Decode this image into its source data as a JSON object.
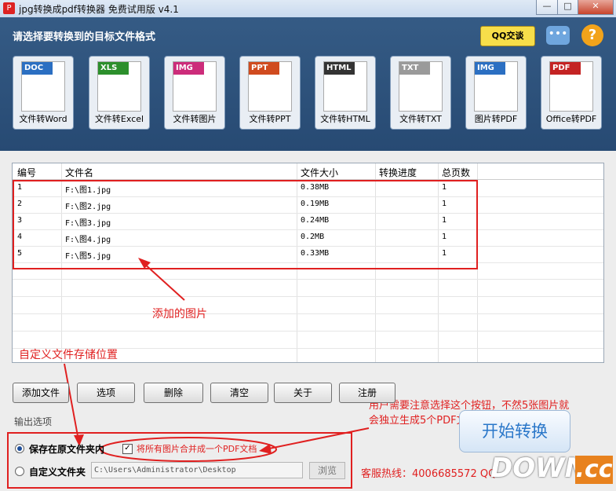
{
  "window": {
    "title": "jpg转换成pdf转换器 免费试用版 v4.1",
    "minimize": "—",
    "maximize": "□",
    "close": "✕"
  },
  "header": {
    "title": "请选择要转换到的目标文件格式",
    "qq_label": "QQ交谈",
    "chat_icon": "speech-bubble-icon",
    "help_icon": "?"
  },
  "formats": [
    {
      "tag": "DOC",
      "label": "文件转Word",
      "color": "#2b6fc2"
    },
    {
      "tag": "XLS",
      "label": "文件转Excel",
      "color": "#2c8f2c"
    },
    {
      "tag": "IMG",
      "label": "文件转图片",
      "color": "#cc2c7a"
    },
    {
      "tag": "PPT",
      "label": "文件转PPT",
      "color": "#d04b1f"
    },
    {
      "tag": "HTML",
      "label": "文件转HTML",
      "color": "#333333"
    },
    {
      "tag": "TXT",
      "label": "文件转TXT",
      "color": "#9a9a9a"
    },
    {
      "tag": "IMG",
      "label": "图片转PDF",
      "color": "#2b6fc2"
    },
    {
      "tag": "PDF",
      "label": "Office转PDF",
      "color": "#c42323"
    }
  ],
  "table": {
    "headers": [
      "编号",
      "文件名",
      "文件大小",
      "转换进度",
      "总页数"
    ],
    "rows": [
      [
        "1",
        "F:\\图1.jpg",
        "0.38MB",
        "",
        "1"
      ],
      [
        "2",
        "F:\\图2.jpg",
        "0.19MB",
        "",
        "1"
      ],
      [
        "3",
        "F:\\图3.jpg",
        "0.24MB",
        "",
        "1"
      ],
      [
        "4",
        "F:\\图4.jpg",
        "0.2MB",
        "",
        "1"
      ],
      [
        "5",
        "F:\\图5.jpg",
        "0.33MB",
        "",
        "1"
      ]
    ]
  },
  "annotations": {
    "added_images": "添加的图片",
    "custom_location": "自定义文件存储位置",
    "note_line1": "用户需要注意选择这个按钮，不然5张图片就",
    "note_line2": "会独立生成5个PDF文件"
  },
  "buttons": {
    "add": "添加文件",
    "options": "选项",
    "delete": "删除",
    "clear": "清空",
    "about": "关于",
    "register": "注册"
  },
  "output": {
    "section_label": "输出选项",
    "save_original": "保存在原文件夹内",
    "custom_folder": "自定义文件夹",
    "merge_label": "将所有图片合并成一个PDF文档",
    "path_value": "C:\\Users\\Administrator\\Desktop",
    "browse": "浏览"
  },
  "start_button": "开始转换",
  "hotline": "客服热线：4006685572 QQ",
  "watermark": {
    "text": "DOWN",
    "suffix": ".cc"
  }
}
